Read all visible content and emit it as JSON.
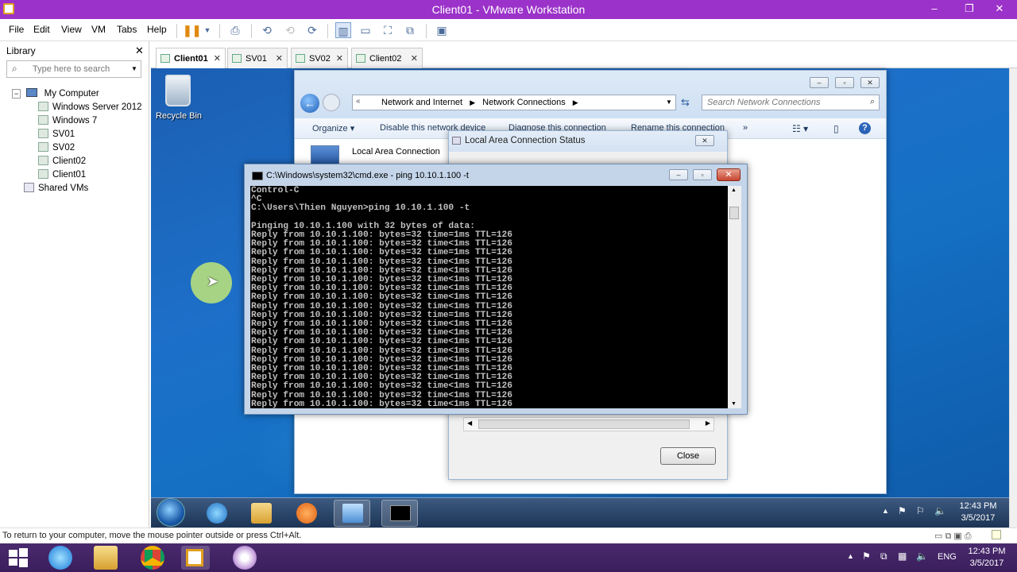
{
  "window": {
    "title": "Client01 - VMware Workstation"
  },
  "menu": [
    "File",
    "Edit",
    "View",
    "VM",
    "Tabs",
    "Help"
  ],
  "library": {
    "title": "Library",
    "search_placeholder": "Type here to search",
    "root": "My Computer",
    "vms": [
      "Windows Server 2012",
      "Windows 7",
      "SV01",
      "SV02",
      "Client02",
      "Client01"
    ],
    "shared": "Shared VMs"
  },
  "tabs": [
    "Client01",
    "SV01",
    "SV02",
    "Client02"
  ],
  "guest": {
    "recycle_bin": "Recycle Bin",
    "explorer": {
      "breadcrumb": [
        "Network and Internet",
        "Network Connections"
      ],
      "search_placeholder": "Search Network Connections",
      "commands": [
        "Organize ▾",
        "Disable this network device",
        "Diagnose this connection",
        "Rename this connection",
        "»"
      ],
      "connection": "Local Area Connection"
    },
    "status_dialog": {
      "title": "Local Area Connection Status",
      "close_label": "Close"
    },
    "cmd": {
      "title": "C:\\Windows\\system32\\cmd.exe - ping  10.10.1.100 -t",
      "lines": [
        "Control-C",
        "^C",
        "C:\\Users\\Thien Nguyen>ping 10.10.1.100 -t",
        "",
        "Pinging 10.10.1.100 with 32 bytes of data:",
        "Reply from 10.10.1.100: bytes=32 time=1ms TTL=126",
        "Reply from 10.10.1.100: bytes=32 time<1ms TTL=126",
        "Reply from 10.10.1.100: bytes=32 time=1ms TTL=126",
        "Reply from 10.10.1.100: bytes=32 time<1ms TTL=126",
        "Reply from 10.10.1.100: bytes=32 time<1ms TTL=126",
        "Reply from 10.10.1.100: bytes=32 time<1ms TTL=126",
        "Reply from 10.10.1.100: bytes=32 time<1ms TTL=126",
        "Reply from 10.10.1.100: bytes=32 time<1ms TTL=126",
        "Reply from 10.10.1.100: bytes=32 time<1ms TTL=126",
        "Reply from 10.10.1.100: bytes=32 time=1ms TTL=126",
        "Reply from 10.10.1.100: bytes=32 time<1ms TTL=126",
        "Reply from 10.10.1.100: bytes=32 time<1ms TTL=126",
        "Reply from 10.10.1.100: bytes=32 time<1ms TTL=126",
        "Reply from 10.10.1.100: bytes=32 time<1ms TTL=126",
        "Reply from 10.10.1.100: bytes=32 time<1ms TTL=126",
        "Reply from 10.10.1.100: bytes=32 time<1ms TTL=126",
        "Reply from 10.10.1.100: bytes=32 time<1ms TTL=126",
        "Reply from 10.10.1.100: bytes=32 time<1ms TTL=126",
        "Reply from 10.10.1.100: bytes=32 time<1ms TTL=126",
        "Reply from 10.10.1.100: bytes=32 time<1ms TTL=126"
      ]
    },
    "clock": {
      "time": "12:43 PM",
      "date": "3/5/2017"
    }
  },
  "statusbar": "To return to your computer, move the mouse pointer outside or press Ctrl+Alt.",
  "host": {
    "lang": "ENG",
    "clock": {
      "time": "12:43 PM",
      "date": "3/5/2017"
    }
  },
  "colors": {
    "vmware_purple": "#9b32c9",
    "guest_desktop": "#1d6fc8",
    "host_taskbar": "#3a1e5c"
  }
}
